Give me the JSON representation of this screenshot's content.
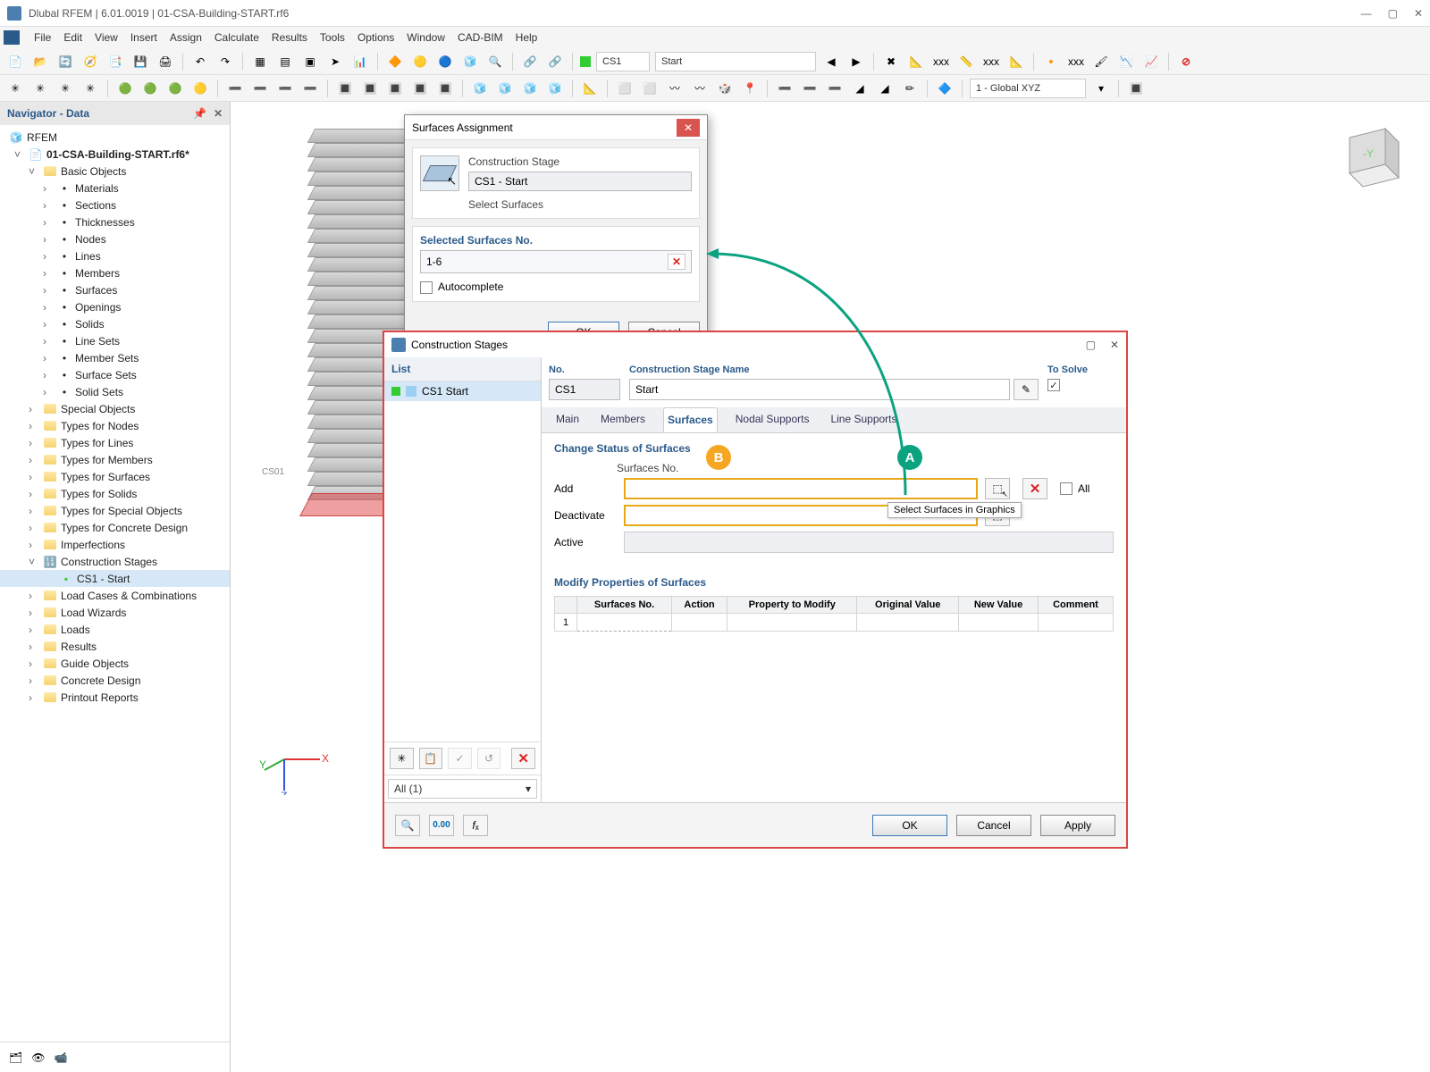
{
  "window": {
    "title": "Dlubal RFEM | 6.01.0019 | 01-CSA-Building-START.rf6"
  },
  "menu": [
    "File",
    "Edit",
    "View",
    "Insert",
    "Assign",
    "Calculate",
    "Results",
    "Tools",
    "Options",
    "Window",
    "CAD-BIM",
    "Help"
  ],
  "toolbar": {
    "stage_code": "CS1",
    "stage_name": "Start",
    "coord_sys": "1 - Global XYZ"
  },
  "navigator": {
    "title": "Navigator - Data",
    "root": "RFEM",
    "file": "01-CSA-Building-START.rf6*",
    "basic_objects": "Basic Objects",
    "basic_children": [
      "Materials",
      "Sections",
      "Thicknesses",
      "Nodes",
      "Lines",
      "Members",
      "Surfaces",
      "Openings",
      "Solids",
      "Line Sets",
      "Member Sets",
      "Surface Sets",
      "Solid Sets"
    ],
    "cats": [
      "Special Objects",
      "Types for Nodes",
      "Types for Lines",
      "Types for Members",
      "Types for Surfaces",
      "Types for Solids",
      "Types for Special Objects",
      "Types for Concrete Design",
      "Imperfections"
    ],
    "construction_stages": "Construction Stages",
    "cs_item": "CS1 - Start",
    "cats2": [
      "Load Cases & Combinations",
      "Load Wizards",
      "Loads",
      "Results",
      "Guide Objects",
      "Concrete Design",
      "Printout Reports"
    ]
  },
  "viewport": {
    "label_cs": "CS01"
  },
  "surfaces_dlg": {
    "title": "Surfaces Assignment",
    "stage_label": "Construction Stage",
    "stage_value": "CS1 - Start",
    "select_label": "Select Surfaces",
    "selected_label": "Selected Surfaces No.",
    "selected_value": "1-6",
    "autocomplete": "Autocomplete",
    "ok": "OK",
    "cancel": "Cancel"
  },
  "cs_dlg": {
    "title": "Construction Stages",
    "list_header": "List",
    "list_item": "CS1  Start",
    "list_filter": "All (1)",
    "no_label": "No.",
    "no_value": "CS1",
    "name_label": "Construction Stage Name",
    "name_value": "Start",
    "solve_label": "To Solve",
    "tabs": [
      "Main",
      "Members",
      "Surfaces",
      "Nodal Supports",
      "Line Supports"
    ],
    "active_tab": "Surfaces",
    "change_status": "Change Status of Surfaces",
    "surfaces_no": "Surfaces No.",
    "add": "Add",
    "deactivate": "Deactivate",
    "active": "Active",
    "all": "All",
    "tooltip": "Select Surfaces in Graphics",
    "modify_header": "Modify Properties of Surfaces",
    "table_headers": [
      "",
      "Surfaces No.",
      "Action",
      "Property to Modify",
      "Original Value",
      "New Value",
      "Comment"
    ],
    "row1": "1",
    "ok": "OK",
    "cancel": "Cancel",
    "apply": "Apply"
  },
  "badges": {
    "A": "A",
    "B": "B"
  }
}
